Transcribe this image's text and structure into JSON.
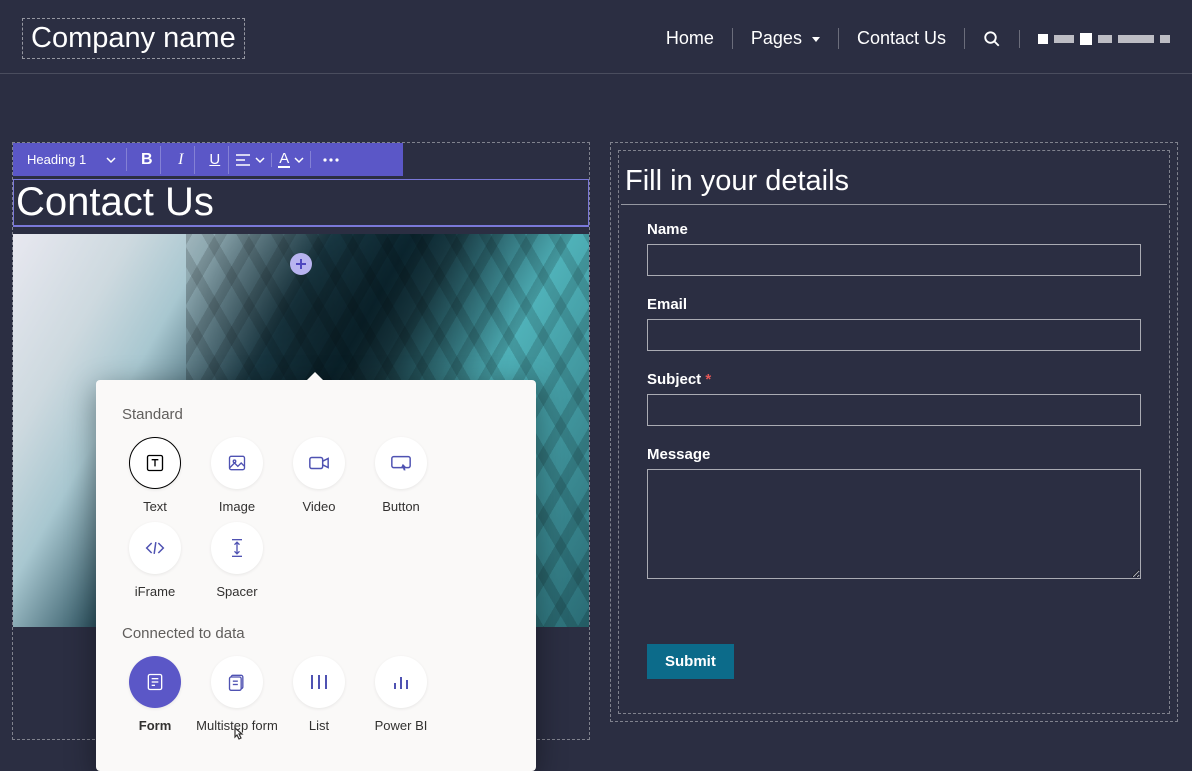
{
  "header": {
    "company_label": "Company name",
    "nav": {
      "home": "Home",
      "pages": "Pages",
      "contact": "Contact Us"
    }
  },
  "toolbar": {
    "style_select": "Heading 1"
  },
  "page": {
    "heading": "Contact Us"
  },
  "popup": {
    "section_standard": "Standard",
    "section_data": "Connected to data",
    "items_standard": {
      "text": "Text",
      "image": "Image",
      "video": "Video",
      "button": "Button",
      "iframe": "iFrame",
      "spacer": "Spacer"
    },
    "items_data": {
      "form": "Form",
      "multistep": "Multistep form",
      "list": "List",
      "powerbi": "Power BI"
    }
  },
  "form": {
    "title": "Fill in your details",
    "fields": {
      "name": "Name",
      "email": "Email",
      "subject": "Subject",
      "required_mark": "*",
      "message": "Message"
    },
    "submit": "Submit"
  }
}
